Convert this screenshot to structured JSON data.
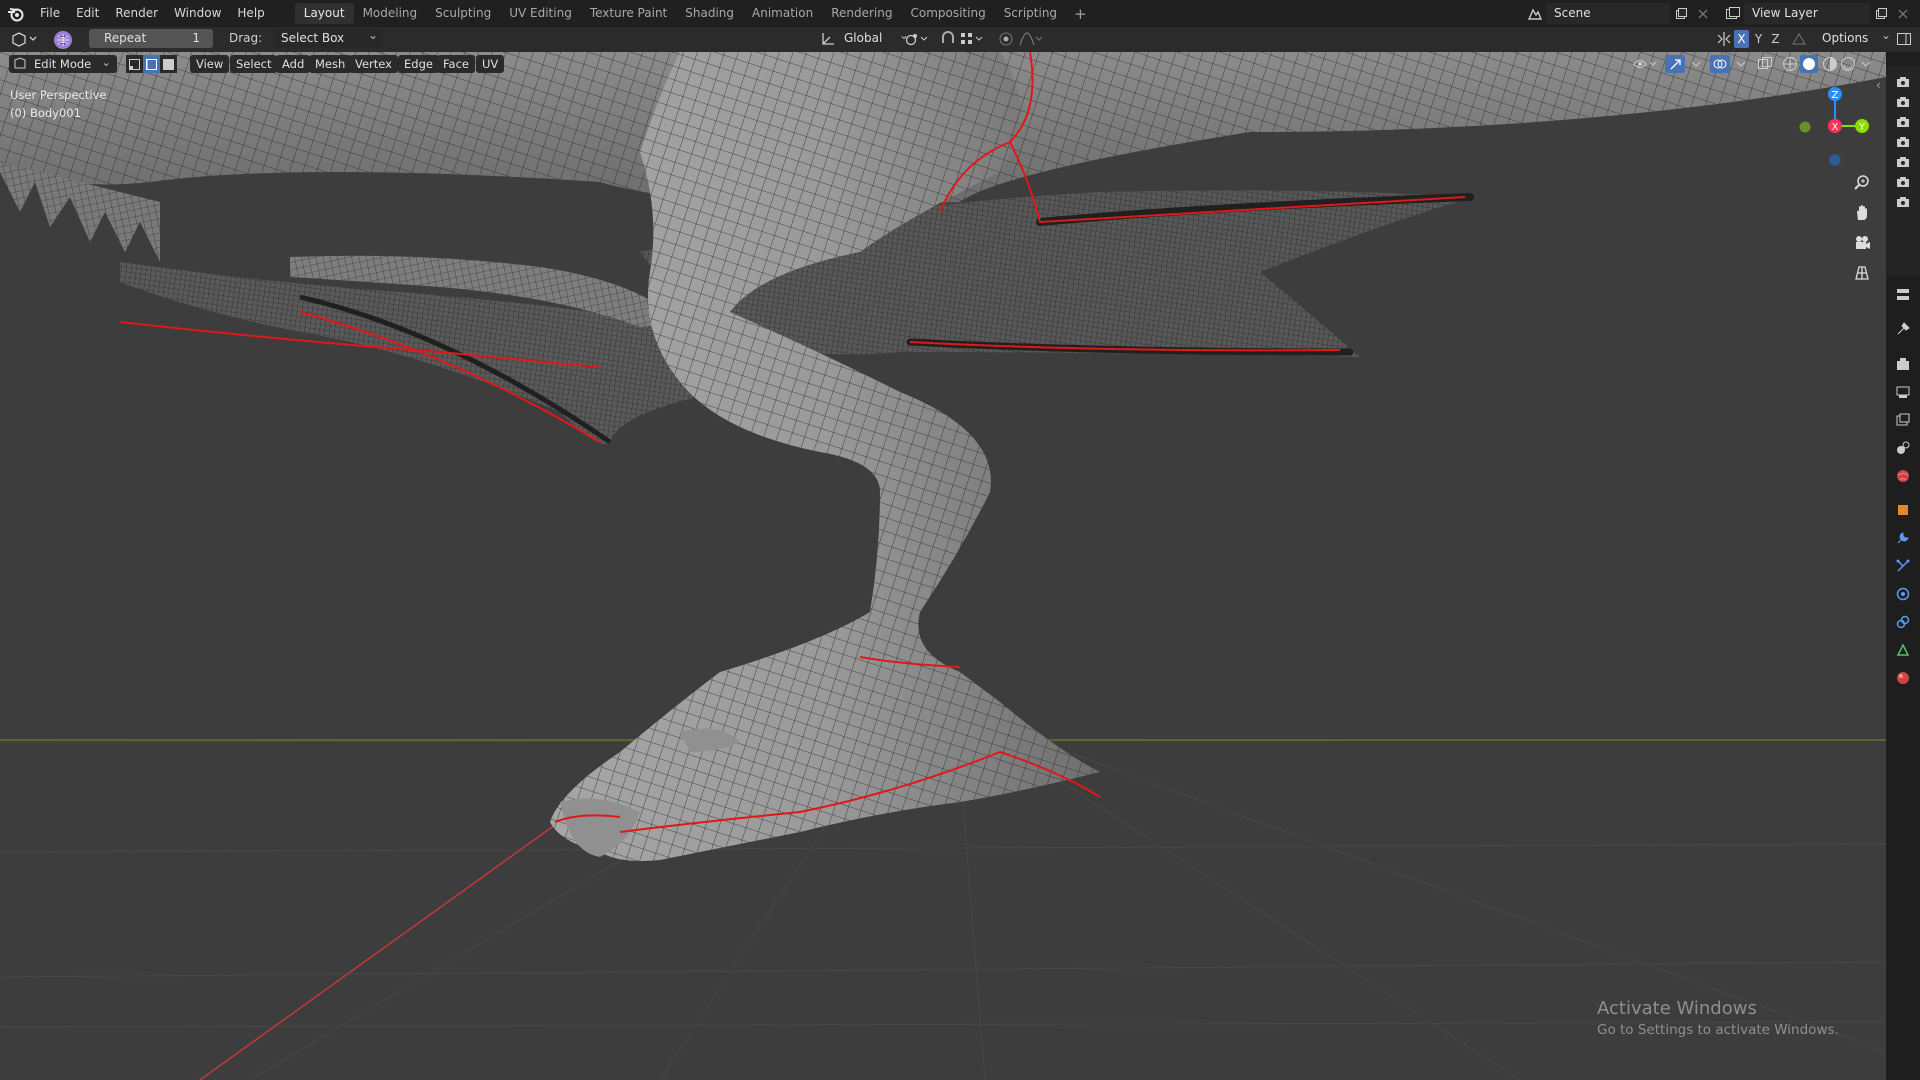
{
  "menu": [
    "File",
    "Edit",
    "Render",
    "Window",
    "Help"
  ],
  "workspaces": {
    "tabs": [
      "Layout",
      "Modeling",
      "Sculpting",
      "UV Editing",
      "Texture Paint",
      "Shading",
      "Animation",
      "Rendering",
      "Compositing",
      "Scripting"
    ],
    "active": "Layout",
    "add_symbol": "+"
  },
  "scene": {
    "name": "Scene"
  },
  "view_layer": {
    "name": "View Layer"
  },
  "tool_header": {
    "repeat_label": "Repeat",
    "repeat_count": "1",
    "drag_label": "Drag:",
    "drag_value": "Select Box",
    "orientation": "Global",
    "axes": [
      "X",
      "Y",
      "Z"
    ],
    "options_label": "Options"
  },
  "viewport_header": {
    "mode": "Edit Mode",
    "menus": [
      "View",
      "Select",
      "Add",
      "Mesh",
      "Vertex",
      "Edge",
      "Face",
      "UV"
    ]
  },
  "viewport": {
    "perspective_label": "User Perspective",
    "object_label": "(0) Body001",
    "gizmo_axes": [
      "Z",
      "X",
      "Y"
    ]
  },
  "watermark": {
    "title": "Activate Windows",
    "subtitle": "Go to Settings to activate Windows."
  },
  "colors": {
    "viewport_bg": "#3d3d3d",
    "mesh_gray": "#8e8e8e",
    "seam_red": "#e01818",
    "accent_blue": "#4772b3",
    "axis_x": "#ff3352",
    "axis_y": "#8bdc00",
    "axis_z": "#2890ff"
  }
}
